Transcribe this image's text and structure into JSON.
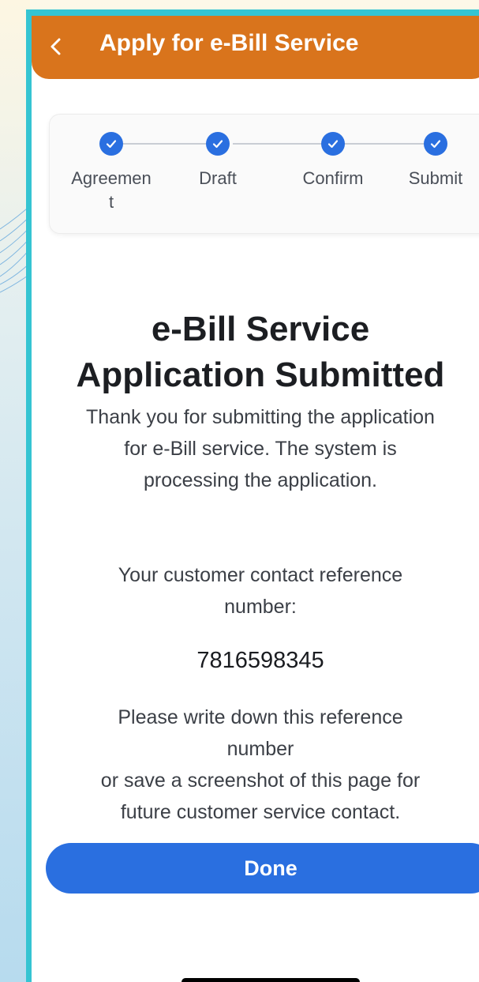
{
  "header": {
    "title": "Apply for e-Bill Service",
    "back_icon": "chevron-left-icon",
    "color": "#d9741c"
  },
  "stepper": {
    "steps": [
      {
        "label": "Agreemen t",
        "done": true
      },
      {
        "label": "Draft",
        "done": true
      },
      {
        "label": "Confirm",
        "done": true
      },
      {
        "label": "Submit",
        "done": true
      }
    ],
    "accent": "#2a6fe0"
  },
  "result": {
    "heading_line1": "e-Bill Service",
    "heading_line2": "Application Submitted",
    "thanks_line1": "Thank you for submitting the application",
    "thanks_line2": "for e-Bill service. The system is",
    "thanks_line3": "processing the application.",
    "ref_line1": "Your customer contact reference",
    "ref_line2": "number:",
    "ref_number": "7816598345",
    "note_line1": "Please write down this reference",
    "note_line2": "number",
    "note_line3": "or save a screenshot of this page for",
    "note_line4": "future customer service contact."
  },
  "actions": {
    "done_label": "Done"
  }
}
